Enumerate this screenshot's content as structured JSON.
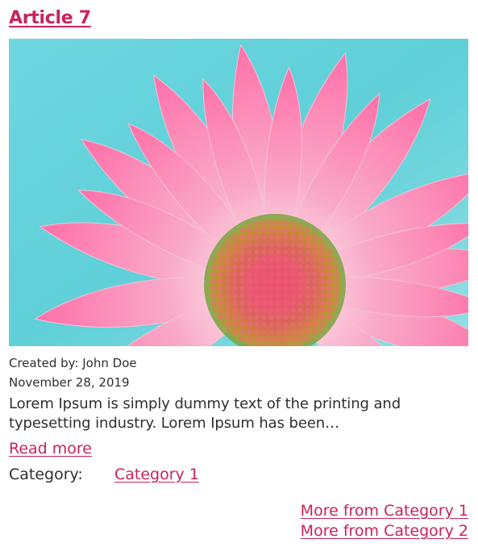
{
  "article": {
    "title": "Article 7",
    "image_subject": "pink daisy flower close-up",
    "author": "Created by: John Doe",
    "date": "November 28, 2019",
    "excerpt": "Lorem Ipsum is simply dummy text of the printing and typesetting industry. Lorem Ipsum has been…",
    "read_more": "Read more",
    "category_label": "Category:",
    "category_link": "Category 1"
  },
  "more_links": [
    "More from Category 1",
    "More from Category 2"
  ],
  "colors": {
    "accent": "#c8235c",
    "text": "#2f2f2f",
    "background": "#ffffff"
  }
}
